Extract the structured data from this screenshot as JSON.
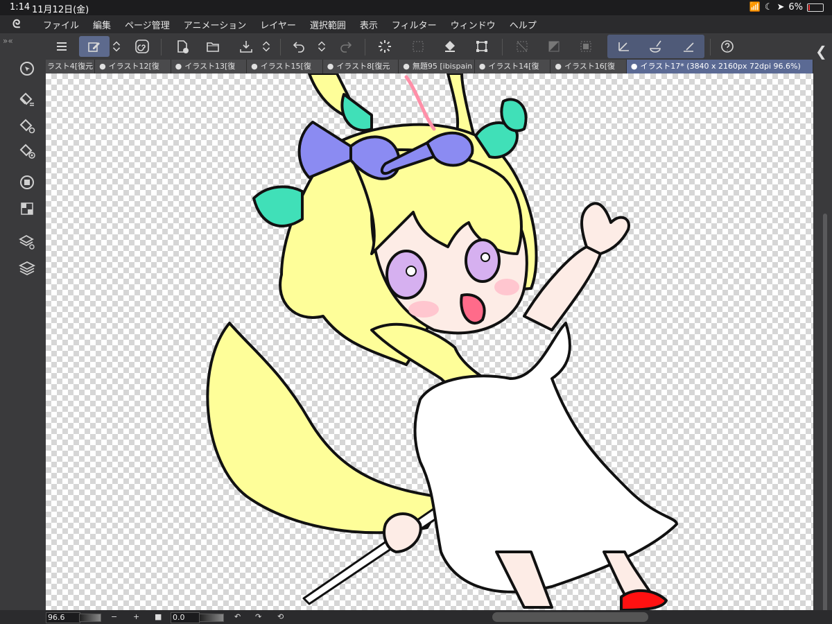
{
  "status": {
    "time": "1:14",
    "date": "11月12日(金)",
    "battery": "6%"
  },
  "menu": [
    "ファイル",
    "編集",
    "ページ管理",
    "アニメーション",
    "レイヤー",
    "選択範囲",
    "表示",
    "フィルター",
    "ウィンドウ",
    "ヘルプ"
  ],
  "tabs": [
    {
      "label": "ラスト4[復元"
    },
    {
      "label": "イラスト12[復"
    },
    {
      "label": "イラスト13[復"
    },
    {
      "label": "イラスト15[復"
    },
    {
      "label": "イラスト8[復元"
    },
    {
      "label": "無題95 [ibispain"
    },
    {
      "label": "イラスト14[復"
    },
    {
      "label": "イラスト16[復"
    },
    {
      "label": "イラスト17* (3840 x 2160px 72dpi 96.6%)"
    }
  ],
  "bottom": {
    "zoom": "96.6",
    "minus": "−",
    "plus": "+",
    "rotation": "0.0"
  },
  "colors": {
    "accent": "#5b6a94",
    "hair": "#fefe99",
    "bow_blue": "#8b8bf2",
    "bow_teal": "#40e0b8",
    "shoe": "#ff1111"
  }
}
